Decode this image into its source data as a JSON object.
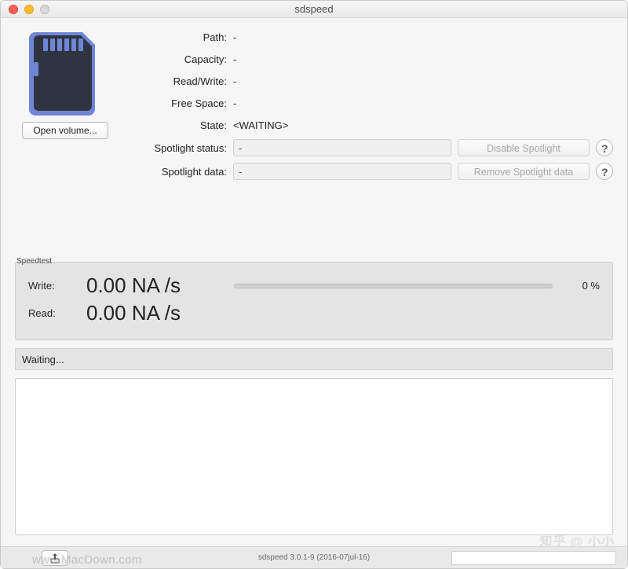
{
  "window": {
    "title": "sdspeed"
  },
  "left": {
    "open_label": "Open volume..."
  },
  "info": {
    "path_label": "Path:",
    "path_value": "-",
    "capacity_label": "Capacity:",
    "capacity_value": "-",
    "rw_label": "Read/Write:",
    "rw_value": "-",
    "free_label": "Free Space:",
    "free_value": "-",
    "state_label": "State:",
    "state_value": "<WAITING>",
    "spot_status_label": "Spotlight status:",
    "spot_status_value": "-",
    "spot_data_label": "Spotlight data:",
    "spot_data_value": "-",
    "disable_spotlight_btn": "Disable Spotlight",
    "remove_spotlight_btn": "Remove Spotlight data",
    "help_glyph": "?"
  },
  "speedtest": {
    "group_title": "Speedtest",
    "write_label": "Write:",
    "write_value": "0.00 NA /s",
    "read_label": "Read:",
    "read_value": "0.00 NA /s",
    "progress_pct": "0 %"
  },
  "status": {
    "text": "Waiting..."
  },
  "footer": {
    "version": "sdspeed 3.0.1-9 (2016-07jul-16)"
  },
  "watermarks": {
    "left": "www.MacDown.com",
    "right": "知乎 @ 小小"
  }
}
